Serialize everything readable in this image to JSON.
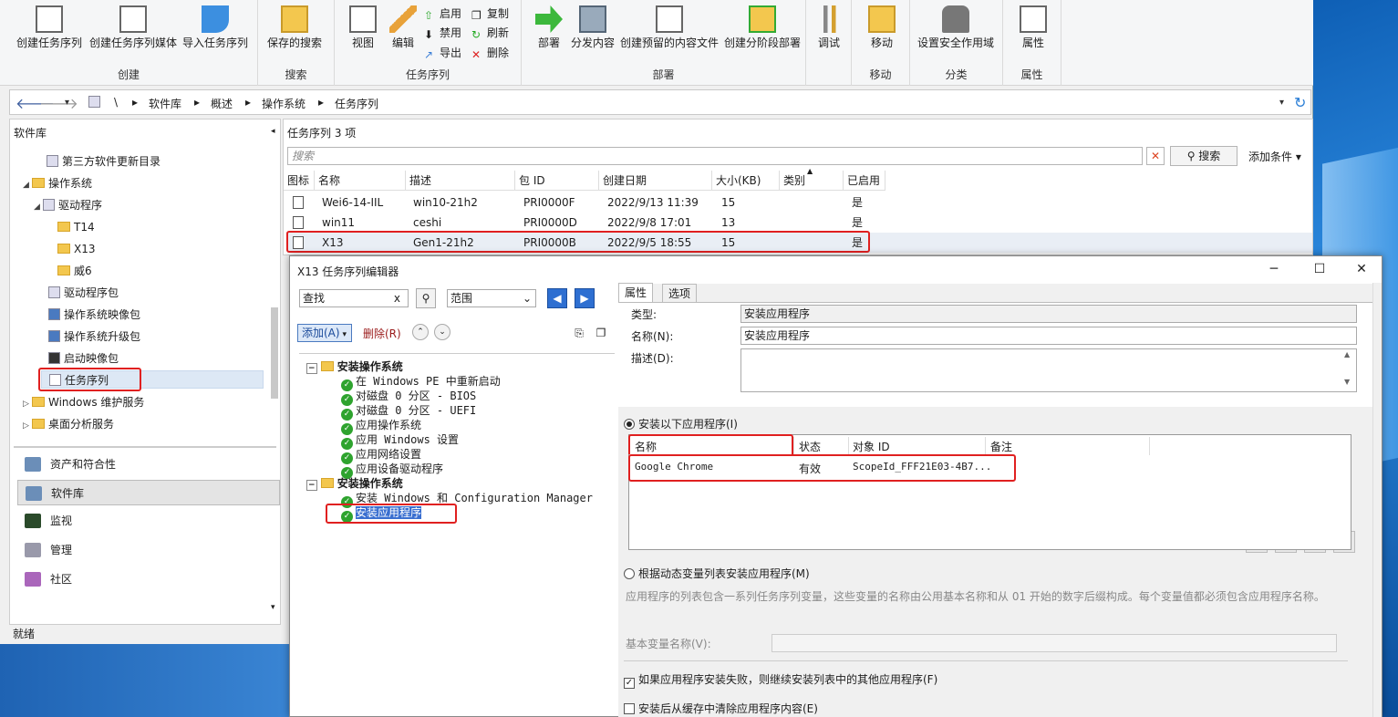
{
  "ribbon": {
    "groups": [
      {
        "label": "创建",
        "buttons": [
          "创建任务序列",
          "创建任务序列媒体",
          "导入任务序列"
        ]
      },
      {
        "label": "搜索",
        "buttons": [
          "保存的搜索"
        ]
      },
      {
        "label": "任务序列",
        "buttons": [
          "视图",
          "编辑"
        ],
        "small": [
          "启用",
          "禁用",
          "导出",
          "复制",
          "刷新",
          "删除"
        ]
      },
      {
        "label": "部署",
        "buttons": [
          "部署",
          "分发内容",
          "创建预留的内容文件",
          "创建分阶段部署"
        ]
      },
      {
        "label": "",
        "buttons": [
          "调试"
        ]
      },
      {
        "label": "移动",
        "buttons": [
          "移动"
        ]
      },
      {
        "label": "分类",
        "buttons": [
          "设置安全作用域"
        ]
      },
      {
        "label": "属性",
        "buttons": [
          "属性"
        ]
      }
    ]
  },
  "address": {
    "crumbs": [
      "\\",
      "软件库",
      "概述",
      "操作系统",
      "任务序列"
    ]
  },
  "left": {
    "header": "软件库",
    "tree": [
      "第三方软件更新目录",
      "操作系统",
      "驱动程序",
      "T14",
      "X13",
      "威6",
      "驱动程序包",
      "操作系统映像包",
      "操作系统升级包",
      "启动映像包",
      "任务序列",
      "Windows 维护服务",
      "桌面分析服务"
    ],
    "workspaces": [
      "资产和符合性",
      "软件库",
      "监视",
      "管理",
      "社区"
    ],
    "status": "就绪"
  },
  "list": {
    "title": "任务序列 3 项",
    "search_placeholder": "搜索",
    "search_button": "搜索",
    "add_condition": "添加条件 ▾",
    "columns": [
      "图标",
      "名称",
      "描述",
      "包 ID",
      "创建日期",
      "大小(KB)",
      "类别",
      "已启用"
    ],
    "rows": [
      [
        "Wei6-14-IIL",
        "win10-21h2",
        "PRI0000F",
        "2022/9/13 11:39",
        "15",
        "",
        "是"
      ],
      [
        "win11",
        "ceshi",
        "PRI0000D",
        "2022/9/8 17:01",
        "13",
        "",
        "是"
      ],
      [
        "X13",
        "Gen1-21h2",
        "PRI0000B",
        "2022/9/5 18:55",
        "15",
        "",
        "是"
      ]
    ]
  },
  "dialog": {
    "title": "X13 任务序列编辑器",
    "find_value": "查找",
    "scope_value": "范围",
    "add_label": "添加(A)",
    "delete_label": "删除(R)",
    "steps": [
      {
        "text": "安装操作系统",
        "group": true
      },
      {
        "text": "在 Windows PE 中重新启动"
      },
      {
        "text": "对磁盘 0 分区 - BIOS"
      },
      {
        "text": "对磁盘 0 分区 - UEFI"
      },
      {
        "text": "应用操作系统"
      },
      {
        "text": "应用 Windows 设置"
      },
      {
        "text": "应用网络设置"
      },
      {
        "text": "应用设备驱动程序"
      },
      {
        "text": "安装操作系统",
        "group": true
      },
      {
        "text": "安装 Windows 和 Configuration Manager"
      },
      {
        "text": "安装应用程序",
        "selected": true
      }
    ],
    "tabs": [
      "属性",
      "选项"
    ],
    "type_label": "类型:",
    "type_value": "安装应用程序",
    "name_label": "名称(N):",
    "name_value": "安装应用程序",
    "desc_label": "描述(D):",
    "radio1": "安装以下应用程序(I)",
    "app_columns": [
      "名称",
      "状态",
      "对象 ID",
      "备注"
    ],
    "app_row": [
      "Google Chrome",
      "有效",
      "ScopeId_FFF21E03-4B7...",
      ""
    ],
    "radio2": "根据动态变量列表安装应用程序(M)",
    "radio2_desc": "应用程序的列表包含一系列任务序列变量，这些变量的名称由公用基本名称和从 01 开始的数字后缀构成。每个变量值都必须包含应用程序名称。",
    "base_var_label": "基本变量名称(V):",
    "check1": "如果应用程序安装失败，则继续安装列表中的其他应用程序(F)",
    "check2": "安装后从缓存中清除应用程序内容(E)"
  }
}
